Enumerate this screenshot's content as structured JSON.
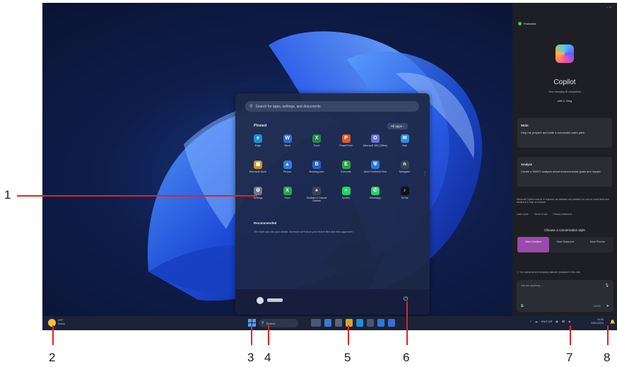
{
  "start_menu": {
    "search_placeholder": "Search for apps, settings, and documents",
    "pinned_label": "Pinned",
    "all_apps_label": "All apps  ›",
    "apps": [
      {
        "label": "Edge",
        "color": "#1b8fd8",
        "glyph": "e"
      },
      {
        "label": "Word",
        "color": "#2b6fd6",
        "glyph": "W"
      },
      {
        "label": "Excel",
        "color": "#1f8a4c",
        "glyph": "X"
      },
      {
        "label": "PowerPoint",
        "color": "#e0592a",
        "glyph": "P"
      },
      {
        "label": "Microsoft 365 (Office)",
        "color": "#6b6fe0",
        "glyph": "O"
      },
      {
        "label": "Mail",
        "color": "#2a8fe6",
        "glyph": "✉"
      },
      {
        "label": "Microsoft Store",
        "color": "#c9932b",
        "glyph": "▦"
      },
      {
        "label": "Photos",
        "color": "#2f7be0",
        "glyph": "▲"
      },
      {
        "label": "Booking.com",
        "color": "#2b5fc9",
        "glyph": "B"
      },
      {
        "label": "Evernote",
        "color": "#2da44a",
        "glyph": "E"
      },
      {
        "label": "Acer ProShield Plus",
        "color": "#2a79d9",
        "glyph": "⛨"
      },
      {
        "label": "Navigator",
        "color": "#3b4258",
        "glyph": "n"
      },
      {
        "label": "Settings",
        "color": "#6f7687",
        "glyph": "⚙"
      },
      {
        "label": "Xbox",
        "color": "#2fa24a",
        "glyph": "X"
      },
      {
        "label": "Solitaire & Casual Games",
        "color": "#3b4258",
        "glyph": "♠"
      },
      {
        "label": "Spotify",
        "color": "#1ed760",
        "glyph": "≈"
      },
      {
        "label": "WhatsApp",
        "color": "#25d366",
        "glyph": "✆"
      },
      {
        "label": "TikTok",
        "color": "#111318",
        "glyph": "♪"
      }
    ],
    "recommended_label": "Recommended",
    "recommended_text": "The more you use your device, the more we'll show your recent files and new apps here."
  },
  "copilot": {
    "window_controls": "–  ×",
    "protected_label": "Protected",
    "title": "Copilot",
    "subtitle": "Your everyday AI companion",
    "bing_label": "with ▷ Bing",
    "cards": [
      {
        "heading": "Write",
        "text": "Help me prepare and write a successful sales pitch"
      },
      {
        "heading": "Analyze",
        "text": "Create a SWOT analysis about environmental goals and impact"
      }
    ],
    "note": "Microsoft Copilot uses AI to respond; as mistakes are possible, be sure to check facts and feedback to help us improve.",
    "links": [
      "Learn more",
      "Terms of use",
      "Privacy statement"
    ],
    "style_title": "Choose a conversation style",
    "styles": [
      {
        "label": "More Creative",
        "selected": true
      },
      {
        "label": "More Balanced",
        "selected": false
      },
      {
        "label": "More Precise",
        "selected": false
      }
    ],
    "warning": "ⓘ Your personal and company data are protected in this chat",
    "input_placeholder": "Ask me anything...",
    "char_count": "0/2000"
  },
  "taskbar": {
    "weather_temp": "29°F",
    "weather_desc": "Sunny",
    "search_label": "Search",
    "tray_items": [
      "^",
      "☁",
      "ENG US",
      "◉",
      "⌧",
      "◈"
    ],
    "time": "10:00",
    "date": "24/01/2024"
  },
  "callouts": [
    "1",
    "2",
    "3",
    "4",
    "5",
    "6",
    "7",
    "8"
  ]
}
